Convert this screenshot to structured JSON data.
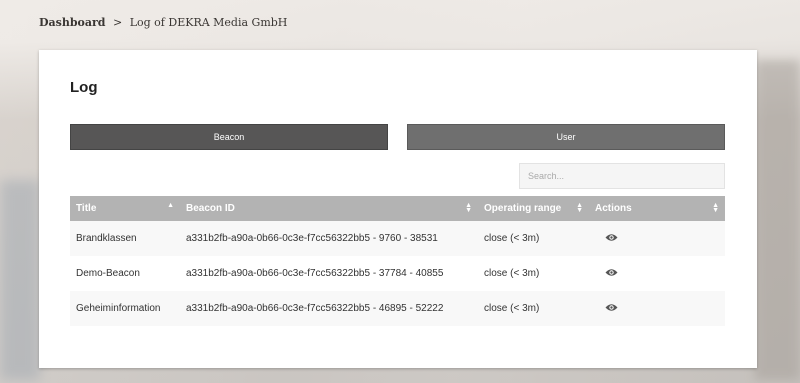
{
  "breadcrumb": {
    "home": "Dashboard",
    "separator": ">",
    "current": "Log of DEKRA Media GmbH"
  },
  "card": {
    "title": "Log"
  },
  "tabs": {
    "beacon": "Beacon",
    "user": "User"
  },
  "search": {
    "placeholder": "Search..."
  },
  "table": {
    "headers": [
      "Title",
      "Beacon ID",
      "Operating range",
      "Actions"
    ],
    "rows": [
      {
        "title": "Brandklassen",
        "beacon_id": "a331b2fb-a90a-0b66-0c3e-f7cc56322bb5 - 9760 - 38531",
        "range": "close (< 3m)",
        "action_icon": "eye-icon"
      },
      {
        "title": "Demo-Beacon",
        "beacon_id": "a331b2fb-a90a-0b66-0c3e-f7cc56322bb5 - 37784 - 40855",
        "range": "close (< 3m)",
        "action_icon": "eye-icon"
      },
      {
        "title": "Geheiminformation",
        "beacon_id": "a331b2fb-a90a-0b66-0c3e-f7cc56322bb5 - 46895 - 52222",
        "range": "close (< 3m)",
        "action_icon": "eye-icon"
      }
    ]
  },
  "colors": {
    "tab_active": "#575656",
    "tab_inactive": "#6f6f6f",
    "table_header": "#b3b3b3"
  }
}
